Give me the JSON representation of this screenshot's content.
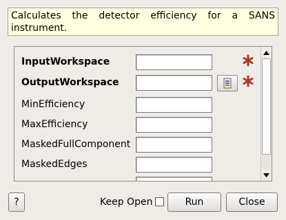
{
  "description": "Calculates the detector efficiency for a SANS instrument.",
  "properties": [
    {
      "label": "InputWorkspace",
      "bold": true,
      "value": "",
      "browse": false,
      "required": true
    },
    {
      "label": "OutputWorkspace",
      "bold": true,
      "value": "",
      "browse": true,
      "required": true
    },
    {
      "label": "MinEfficiency",
      "bold": false,
      "value": "",
      "browse": false,
      "required": false
    },
    {
      "label": "MaxEfficiency",
      "bold": false,
      "value": "",
      "browse": false,
      "required": false
    },
    {
      "label": "MaskedFullComponent",
      "bold": false,
      "value": "",
      "browse": false,
      "required": false
    },
    {
      "label": "MaskedEdges",
      "bold": false,
      "value": "",
      "browse": false,
      "required": false
    }
  ],
  "buttons": {
    "help": "?",
    "run": "Run",
    "close": "Close"
  },
  "keep_open": {
    "label": "Keep Open",
    "checked": false
  },
  "colors": {
    "required_star": "#a8392a",
    "description_bg": "#ffffe1",
    "window_bg": "#efebe7"
  },
  "icons": {
    "browse": "workspace-browse-icon",
    "required": "asterisk-icon"
  }
}
